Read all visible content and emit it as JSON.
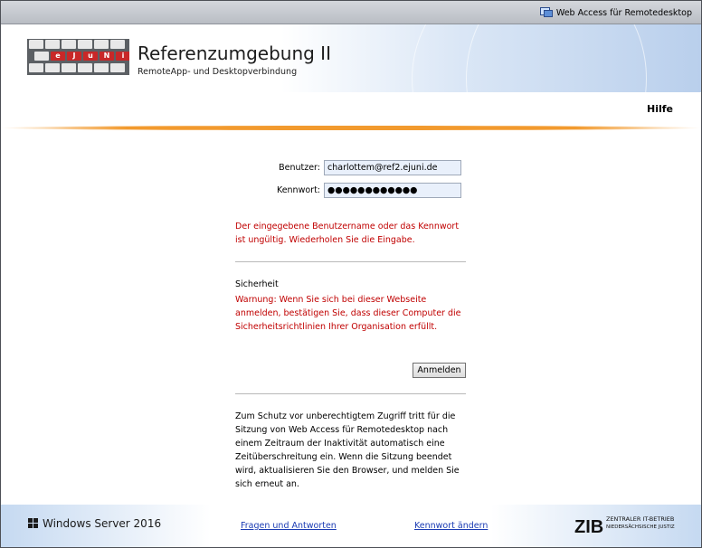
{
  "topbar": {
    "brand": "Web Access für Remotedesktop",
    "icon": "remote-desktop-icon"
  },
  "header": {
    "title": "Referenzumgebung II",
    "subtitle": "RemoteApp- und Desktopverbindung",
    "logo_letters": [
      "e",
      "J",
      "u",
      "N",
      "i"
    ]
  },
  "nav": {
    "help": "Hilfe"
  },
  "form": {
    "user_label": "Benutzer:",
    "user_value": "charlottem@ref2.ejuni.de",
    "password_label": "Kennwort:",
    "password_value": "●●●●●●●●●●●●",
    "error": "Der eingegebene Benutzername oder das Kennwort ist ungültig. Wiederholen Sie die Eingabe.",
    "security_title": "Sicherheit",
    "security_warning": "Warnung: Wenn Sie sich bei dieser Webseite anmelden, bestätigen Sie, dass dieser Computer die Sicherheitsrichtlinien Ihrer Organisation erfüllt.",
    "login_button": "Anmelden",
    "info": "Zum Schutz vor unberechtigtem Zugriff tritt für die Sitzung von Web Access für Remotedesktop nach einem Zeitraum der Inaktivität automatisch eine Zeitüberschreitung ein. Wenn die Sitzung beendet wird, aktualisieren Sie den Browser, und melden Sie sich erneut an."
  },
  "footer": {
    "windows": "Windows Server 2016",
    "faq": "Fragen und Antworten",
    "change_password": "Kennwort ändern",
    "zib_mark": "ZIB",
    "zib_line1": "ZENTRALER IT-BETRIEB",
    "zib_line2": "NIEDERSÄCHSISCHE JUSTIZ"
  },
  "colors": {
    "error": "#c00000",
    "link": "#1a3bb3",
    "accent": "#f29a2e"
  }
}
